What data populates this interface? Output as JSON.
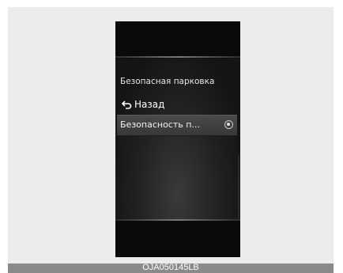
{
  "menu": {
    "title": "Безопасная парковка",
    "back_label": "Назад",
    "items": [
      {
        "label": "Безопасность п...",
        "selected": true
      }
    ]
  },
  "caption": "OJA050145LB",
  "colors": {
    "frame_bg": "#ececec",
    "screen_bg": "#0f0f0f",
    "selected_item_bg": "#404040",
    "caption_bar": "#8a8a8a"
  },
  "icons": [
    "back-arrow-icon",
    "radio-button-icon"
  ]
}
